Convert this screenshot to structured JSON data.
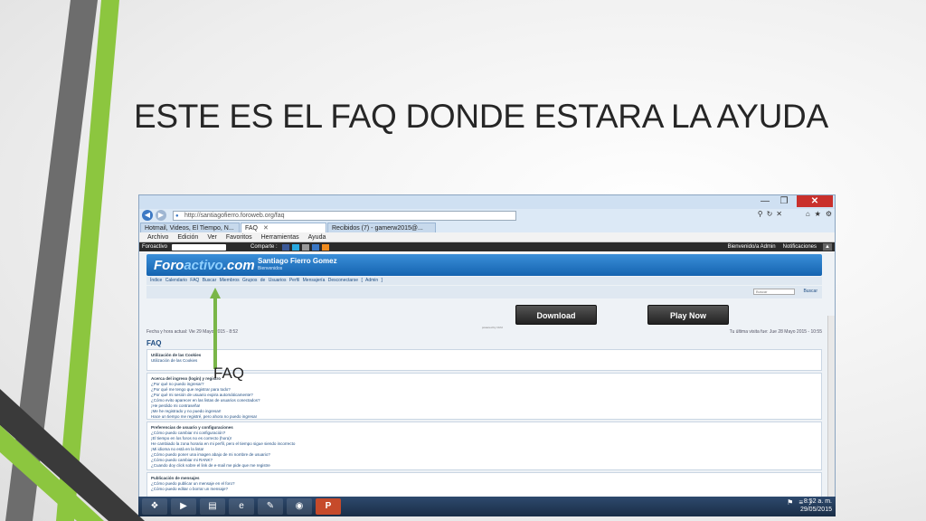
{
  "slide": {
    "title": "ESTE ES EL FAQ DONDE ESTARA LA AYUDA"
  },
  "browser": {
    "url": "http://santiagofierro.foroweb.org/faq",
    "tabs": [
      {
        "label": "Hotmail, Videos, El Tiempo, N..."
      },
      {
        "label": "FAQ"
      },
      {
        "label": "Recibidos (7) - gamerw2015@..."
      }
    ],
    "menu": [
      "Archivo",
      "Edición",
      "Ver",
      "Favoritos",
      "Herramientas",
      "Ayuda"
    ],
    "forumbar": {
      "brand": "Foroactivo",
      "share": "Comparte :",
      "welcome": "Bienvenido/a Admin",
      "notifications": "Notificaciones"
    }
  },
  "forum": {
    "logo_a": "Foro",
    "logo_b": "activo",
    "logo_c": ".com",
    "site_name": "Santiago Fierro Gomez",
    "site_sub": "Bienvenidos",
    "nav": "Índice Calendario FAQ Buscar Miembros Grupos de Usuarios Perfil Mensajería Desconectarse [ Admin ]",
    "search_placeholder": "Buscar",
    "search_button": "Buscar",
    "download": "Download",
    "play_now": "Play Now",
    "powered": "powered by Ctrld",
    "date": "Fecha y hora actual: Vie 29 Mayo 2015 - 8:52",
    "last_visit": "Tu última visita fue: Jue 28 Mayo 2015 - 10:55",
    "faq_heading": "FAQ",
    "panels": [
      {
        "head": "Utilización de las Cookies",
        "lines": [
          "Utilización de las Cookies"
        ]
      },
      {
        "head": "Acerca del ingreso (login) y registro",
        "lines": [
          "¿Por qué no puedo ingresar?",
          "¿Por qué me tengo que registrar para todo?",
          "¿Por qué mi sesión de usuario expira automáticamente?",
          "¿Cómo evito aparecer en las listas de usuarios conectados?",
          "¡He perdido mi contraseña!",
          "¡Me he registrado y no puedo ingresar!",
          "Hace un tiempo me registré, pero ahora no puedo ingresar"
        ]
      },
      {
        "head": "Preferencias de usuario y configuraciones",
        "lines": [
          "¿Cómo puedo cambiar mi configuración?",
          "¡El tiempo en los foros no es correcto (hora)!",
          "He cambiado la zona horaria en mi perfil, pero el tiempo sigue siendo incorrecto",
          "¡Mi idioma no está en la lista!",
          "¿Cómo puedo poner una imagen abajo de mi nombre de usuario?",
          "¿Cómo puedo cambiar mi RANK?",
          "¿Cuando doy click sobre el link de e-mail me pide que me registre"
        ]
      },
      {
        "head": "Publicación de mensajes",
        "lines": [
          "¿Cómo puedo publicar un mensaje en el foro?",
          "¿Cómo puedo editar o borrar un mensaje?"
        ]
      }
    ]
  },
  "taskbar": {
    "clock_time": "8:52 a. m.",
    "clock_date": "29/05/2015"
  },
  "annotation": {
    "label": "FAQ"
  },
  "colors": {
    "accent_green": "#8cc63f",
    "deco_gray": "#6d6d6d",
    "forum_blue": "#1564b0"
  }
}
